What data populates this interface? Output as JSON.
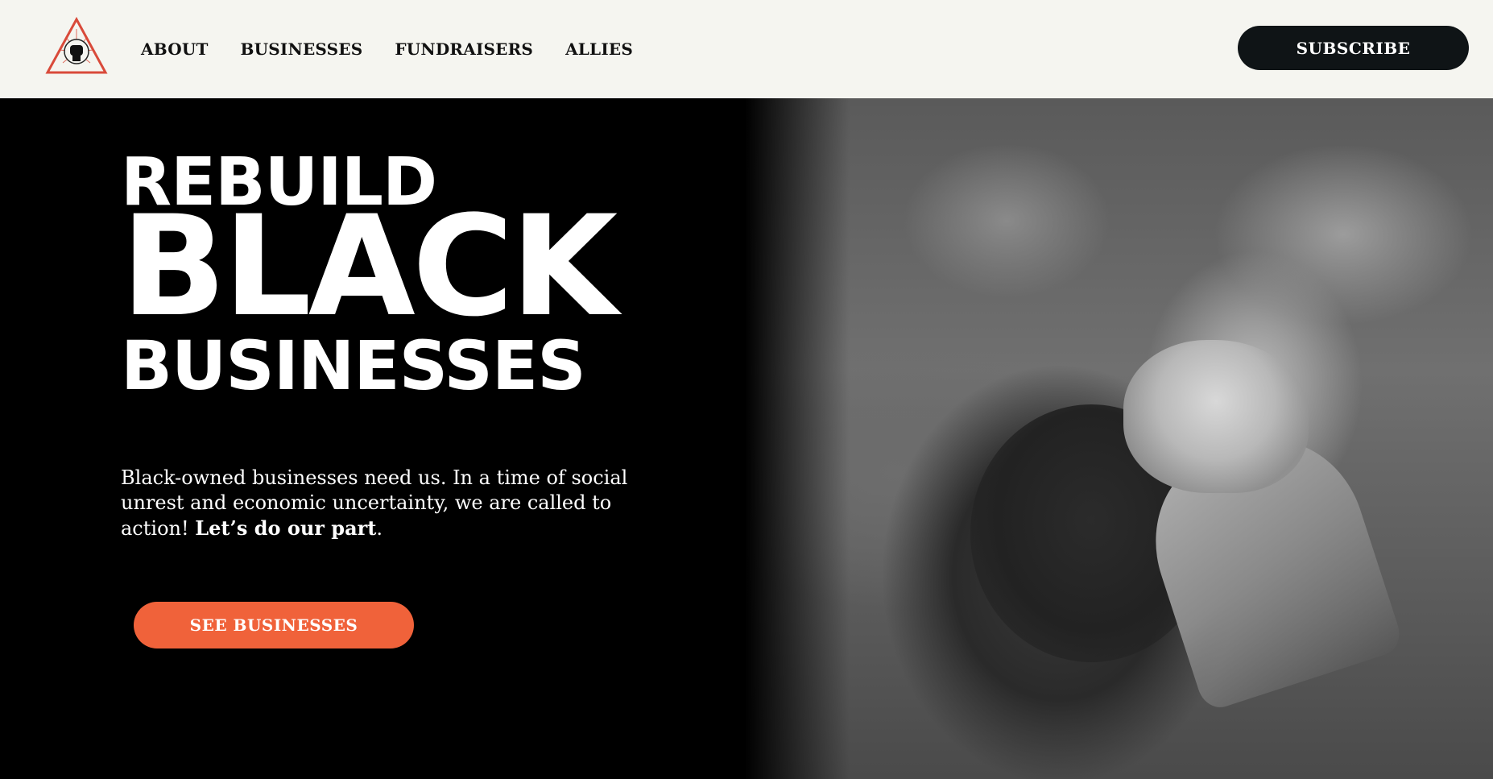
{
  "header": {
    "logo_icon": "raised-fist-triangle-icon",
    "nav": [
      {
        "label": "ABOUT"
      },
      {
        "label": "BUSINESSES"
      },
      {
        "label": "FUNDRAISERS"
      },
      {
        "label": "ALLIES"
      }
    ],
    "subscribe_label": "SUBSCRIBE"
  },
  "hero": {
    "title_line1": "REBUILD",
    "title_line2": "BLACK",
    "title_line3": "BUSINESSES",
    "description_main": "Black-owned businesses need us. In a time of social unrest and economic uncertainty, we are called to action! ",
    "description_emphasis": "Let’s do our part",
    "description_end": ".",
    "cta_label": "SEE BUSINESSES"
  },
  "colors": {
    "header_bg": "#f5f5f0",
    "hero_bg": "#000000",
    "accent": "#f0623a",
    "button_dark": "#0f1416",
    "logo_red": "#d94a3a"
  }
}
